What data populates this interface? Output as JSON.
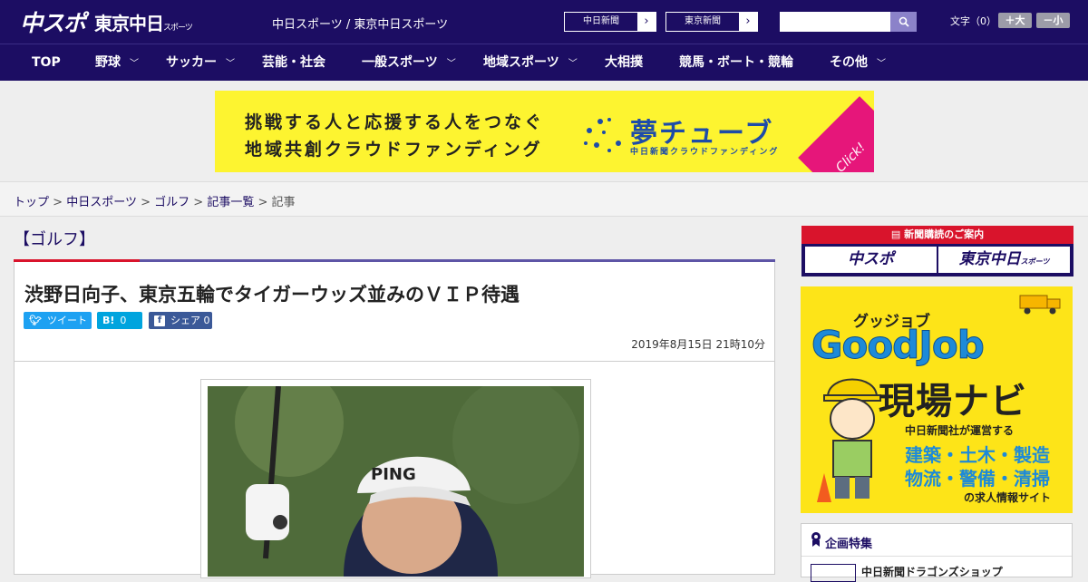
{
  "header": {
    "logo_main": "中スポ",
    "logo_sub": "東京中日",
    "logo_sub_small": "スポーツ",
    "site_links": "中日スポーツ / 東京中日スポーツ",
    "paper_buttons": [
      {
        "label": "中日新聞"
      },
      {
        "label": "東京新聞"
      }
    ],
    "search": {
      "placeholder": ""
    },
    "font_size": {
      "label": "文字（0）",
      "larger": "＋大",
      "smaller": "－小"
    }
  },
  "nav": {
    "items": [
      {
        "label": "TOP",
        "has_menu": false
      },
      {
        "label": "野球",
        "has_menu": true
      },
      {
        "label": "サッカー",
        "has_menu": true
      },
      {
        "label": "芸能・社会",
        "has_menu": false
      },
      {
        "label": "一般スポーツ",
        "has_menu": true
      },
      {
        "label": "地域スポーツ",
        "has_menu": true
      },
      {
        "label": "大相撲",
        "has_menu": false
      },
      {
        "label": "競馬・ボート・競輪",
        "has_menu": false
      },
      {
        "label": "その他",
        "has_menu": true
      }
    ]
  },
  "banner": {
    "line1": "挑戦する人と応援する人をつなぐ",
    "line2": "地域共創クラウドファンディング",
    "logo": "夢チューブ",
    "logo_sub": "中日新聞クラウドファンディング",
    "click": "Click!"
  },
  "breadcrumb": {
    "items": [
      "トップ",
      "中日スポーツ",
      "ゴルフ",
      "記事一覧"
    ],
    "current": "記事",
    "separator": ">"
  },
  "article": {
    "category": "【ゴルフ】",
    "title": "渋野日向子、東京五輪でタイガーウッズ並みのＶＩＰ待遇",
    "share": {
      "tweet": "ツイート",
      "hatena_icon": "B!",
      "hatena_count": "0",
      "facebook_label": "シェア",
      "facebook_count": "0"
    },
    "date": "2019年8月15日 21時10分",
    "photo_text": "PING"
  },
  "sidebar": {
    "subscribe": {
      "heading": "新聞購読のご案内",
      "left": "中スポ",
      "right": "東京中日",
      "right_small": "スポーツ"
    },
    "ad": {
      "small": "グッジョブ",
      "big": "GoodJob",
      "navi": "現場ナビ",
      "line1": "中日新聞社が運営する",
      "line2": "建築・土木・製造",
      "line3": "物流・警備・清掃",
      "line4": "の求人情報サイト"
    },
    "features": {
      "title": "企画特集",
      "item": "中日新聞ドラゴンズショップ"
    }
  },
  "colors": {
    "brand_navy": "#1c0d63",
    "accent_red": "#d9142c",
    "twitter": "#1da1f2",
    "hatena": "#00a4de",
    "facebook": "#3b5998"
  }
}
